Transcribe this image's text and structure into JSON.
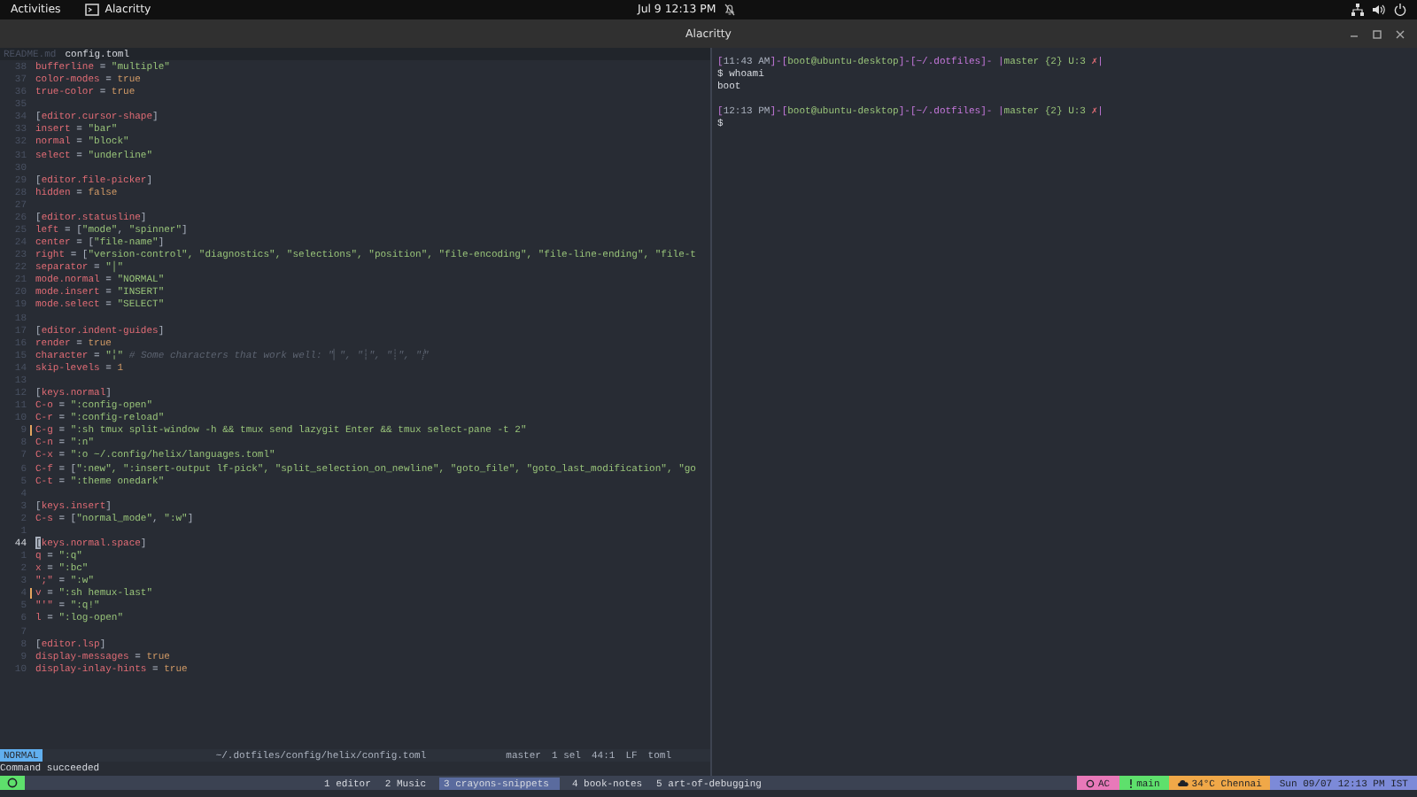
{
  "top_bar": {
    "activities": "Activities",
    "app": "Alacritty",
    "clock": "Jul 9  12:13 PM"
  },
  "window": {
    "title": "Alacritty"
  },
  "editor": {
    "tabs": [
      {
        "label": "README.md",
        "selected": false
      },
      {
        "label": "config.toml",
        "selected": true
      }
    ],
    "lines": [
      {
        "number": "38",
        "current": false,
        "modified": false,
        "tokens": [
          {
            "kind": "key",
            "text": "bufferline"
          },
          {
            "kind": "punct",
            "text": " = "
          },
          {
            "kind": "string",
            "text": "\"multiple\""
          }
        ]
      },
      {
        "number": "37",
        "current": false,
        "modified": false,
        "tokens": [
          {
            "kind": "key",
            "text": "color-modes"
          },
          {
            "kind": "punct",
            "text": " = "
          },
          {
            "kind": "value",
            "text": "true"
          }
        ]
      },
      {
        "number": "36",
        "current": false,
        "modified": false,
        "tokens": [
          {
            "kind": "key",
            "text": "true-color"
          },
          {
            "kind": "punct",
            "text": " = "
          },
          {
            "kind": "value",
            "text": "true"
          }
        ]
      },
      {
        "number": "35",
        "current": false,
        "modified": false
      },
      {
        "number": "34",
        "current": false,
        "modified": false,
        "tokens": [
          {
            "kind": "punct",
            "text": "["
          },
          {
            "kind": "key",
            "text": "editor.cursor-shape"
          },
          {
            "kind": "punct",
            "text": "]"
          }
        ]
      },
      {
        "number": "33",
        "current": false,
        "modified": false,
        "tokens": [
          {
            "kind": "key",
            "text": "insert"
          },
          {
            "kind": "punct",
            "text": " = "
          },
          {
            "kind": "string",
            "text": "\"bar\""
          }
        ]
      },
      {
        "number": "32",
        "current": false,
        "modified": false,
        "tokens": [
          {
            "kind": "key",
            "text": "normal"
          },
          {
            "kind": "punct",
            "text": " = "
          },
          {
            "kind": "string",
            "text": "\"block\""
          }
        ]
      },
      {
        "number": "31",
        "current": false,
        "modified": false,
        "tokens": [
          {
            "kind": "key",
            "text": "select"
          },
          {
            "kind": "punct",
            "text": " = "
          },
          {
            "kind": "string",
            "text": "\"underline\""
          }
        ]
      },
      {
        "number": "30",
        "current": false,
        "modified": false
      },
      {
        "number": "29",
        "current": false,
        "modified": false,
        "tokens": [
          {
            "kind": "punct",
            "text": "["
          },
          {
            "kind": "key",
            "text": "editor.file-picker"
          },
          {
            "kind": "punct",
            "text": "]"
          }
        ]
      },
      {
        "number": "28",
        "current": false,
        "modified": false,
        "tokens": [
          {
            "kind": "key",
            "text": "hidden"
          },
          {
            "kind": "punct",
            "text": " = "
          },
          {
            "kind": "value",
            "text": "false"
          }
        ]
      },
      {
        "number": "27",
        "current": false,
        "modified": false
      },
      {
        "number": "26",
        "current": false,
        "modified": false,
        "tokens": [
          {
            "kind": "punct",
            "text": "["
          },
          {
            "kind": "key",
            "text": "editor.statusline"
          },
          {
            "kind": "punct",
            "text": "]"
          }
        ]
      },
      {
        "number": "25",
        "current": false,
        "modified": false,
        "tokens": [
          {
            "kind": "key",
            "text": "left"
          },
          {
            "kind": "punct",
            "text": " = ["
          },
          {
            "kind": "string",
            "text": "\"mode\""
          },
          {
            "kind": "punct",
            "text": ", "
          },
          {
            "kind": "string",
            "text": "\"spinner\""
          },
          {
            "kind": "punct",
            "text": "]"
          }
        ]
      },
      {
        "number": "24",
        "current": false,
        "modified": false,
        "tokens": [
          {
            "kind": "key",
            "text": "center"
          },
          {
            "kind": "punct",
            "text": " = ["
          },
          {
            "kind": "string",
            "text": "\"file-name\""
          },
          {
            "kind": "punct",
            "text": "]"
          }
        ]
      },
      {
        "number": "23",
        "current": false,
        "modified": false,
        "tokens": [
          {
            "kind": "key",
            "text": "right"
          },
          {
            "kind": "punct",
            "text": " = ["
          },
          {
            "kind": "string",
            "text": "\"version-control\", \"diagnostics\", \"selections\", \"position\", \"file-encoding\", \"file-line-ending\", \"file-t"
          }
        ]
      },
      {
        "number": "22",
        "current": false,
        "modified": false,
        "tokens": [
          {
            "kind": "key",
            "text": "separator"
          },
          {
            "kind": "punct",
            "text": " = "
          },
          {
            "kind": "string",
            "text": "\"│\""
          }
        ]
      },
      {
        "number": "21",
        "current": false,
        "modified": false,
        "tokens": [
          {
            "kind": "key",
            "text": "mode.normal"
          },
          {
            "kind": "punct",
            "text": " = "
          },
          {
            "kind": "string",
            "text": "\"NORMAL\""
          }
        ]
      },
      {
        "number": "20",
        "current": false,
        "modified": false,
        "tokens": [
          {
            "kind": "key",
            "text": "mode.insert"
          },
          {
            "kind": "punct",
            "text": " = "
          },
          {
            "kind": "string",
            "text": "\"INSERT\""
          }
        ]
      },
      {
        "number": "19",
        "current": false,
        "modified": false,
        "tokens": [
          {
            "kind": "key",
            "text": "mode.select"
          },
          {
            "kind": "punct",
            "text": " = "
          },
          {
            "kind": "string",
            "text": "\"SELECT\""
          }
        ]
      },
      {
        "number": "18",
        "current": false,
        "modified": false
      },
      {
        "number": "17",
        "current": false,
        "modified": false,
        "tokens": [
          {
            "kind": "punct",
            "text": "["
          },
          {
            "kind": "key",
            "text": "editor.indent-guides"
          },
          {
            "kind": "punct",
            "text": "]"
          }
        ]
      },
      {
        "number": "16",
        "current": false,
        "modified": false,
        "tokens": [
          {
            "kind": "key",
            "text": "render"
          },
          {
            "kind": "punct",
            "text": " = "
          },
          {
            "kind": "value",
            "text": "true"
          }
        ]
      },
      {
        "number": "15",
        "current": false,
        "modified": false,
        "tokens": [
          {
            "kind": "key",
            "text": "character"
          },
          {
            "kind": "punct",
            "text": " = "
          },
          {
            "kind": "string",
            "text": "\"╎\""
          },
          {
            "kind": "comment",
            "text": " # Some characters that work well: \"▏\", \"┆\", \"┊\", \"⸽\""
          }
        ]
      },
      {
        "number": "14",
        "current": false,
        "modified": false,
        "tokens": [
          {
            "kind": "key",
            "text": "skip-levels"
          },
          {
            "kind": "punct",
            "text": " = "
          },
          {
            "kind": "value",
            "text": "1"
          }
        ]
      },
      {
        "number": "13",
        "current": false,
        "modified": false
      },
      {
        "number": "12",
        "current": false,
        "modified": false,
        "tokens": [
          {
            "kind": "punct",
            "text": "["
          },
          {
            "kind": "key",
            "text": "keys.normal"
          },
          {
            "kind": "punct",
            "text": "]"
          }
        ]
      },
      {
        "number": "11",
        "current": false,
        "modified": false,
        "tokens": [
          {
            "kind": "key",
            "text": "C-o"
          },
          {
            "kind": "punct",
            "text": " = "
          },
          {
            "kind": "string",
            "text": "\":config-open\""
          }
        ]
      },
      {
        "number": "10",
        "current": false,
        "modified": false,
        "tokens": [
          {
            "kind": "key",
            "text": "C-r"
          },
          {
            "kind": "punct",
            "text": " = "
          },
          {
            "kind": "string",
            "text": "\":config-reload\""
          }
        ]
      },
      {
        "number": "9",
        "current": false,
        "modified": true,
        "tokens": [
          {
            "kind": "key",
            "text": "C-g"
          },
          {
            "kind": "punct",
            "text": " = "
          },
          {
            "kind": "string",
            "text": "\":sh tmux split-window -h && tmux send lazygit Enter && tmux select-pane -t 2\""
          }
        ]
      },
      {
        "number": "8",
        "current": false,
        "modified": false,
        "tokens": [
          {
            "kind": "key",
            "text": "C-n"
          },
          {
            "kind": "punct",
            "text": " = "
          },
          {
            "kind": "string",
            "text": "\":n\""
          }
        ]
      },
      {
        "number": "7",
        "current": false,
        "modified": false,
        "tokens": [
          {
            "kind": "key",
            "text": "C-x"
          },
          {
            "kind": "punct",
            "text": " = "
          },
          {
            "kind": "string",
            "text": "\":o ~/.config/helix/languages.toml\""
          }
        ]
      },
      {
        "number": "6",
        "current": false,
        "modified": false,
        "tokens": [
          {
            "kind": "key",
            "text": "C-f"
          },
          {
            "kind": "punct",
            "text": " = ["
          },
          {
            "kind": "string",
            "text": "\":new\", \":insert-output lf-pick\", \"split_selection_on_newline\", \"goto_file\", \"goto_last_modification\", \"go"
          }
        ]
      },
      {
        "number": "5",
        "current": false,
        "modified": false,
        "tokens": [
          {
            "kind": "key",
            "text": "C-t"
          },
          {
            "kind": "punct",
            "text": " = "
          },
          {
            "kind": "string",
            "text": "\":theme onedark\""
          }
        ]
      },
      {
        "number": "4",
        "current": false,
        "modified": false
      },
      {
        "number": "3",
        "current": false,
        "modified": false,
        "tokens": [
          {
            "kind": "punct",
            "text": "["
          },
          {
            "kind": "key",
            "text": "keys.insert"
          },
          {
            "kind": "punct",
            "text": "]"
          }
        ]
      },
      {
        "number": "2",
        "current": false,
        "modified": false,
        "tokens": [
          {
            "kind": "key",
            "text": "C-s"
          },
          {
            "kind": "punct",
            "text": " = ["
          },
          {
            "kind": "string",
            "text": "\"normal_mode\""
          },
          {
            "kind": "punct",
            "text": ", "
          },
          {
            "kind": "string",
            "text": "\":w\""
          },
          {
            "kind": "punct",
            "text": "]"
          }
        ]
      },
      {
        "number": "1",
        "current": false,
        "modified": false
      },
      {
        "number": "44",
        "current": true,
        "modified": false,
        "tokens": [
          {
            "kind": "punct",
            "text": "["
          },
          {
            "kind": "key",
            "text": "keys.normal.space"
          },
          {
            "kind": "punct",
            "text": "]"
          }
        ]
      },
      {
        "number": "1",
        "current": false,
        "modified": false,
        "tokens": [
          {
            "kind": "key",
            "text": "q"
          },
          {
            "kind": "punct",
            "text": " = "
          },
          {
            "kind": "string",
            "text": "\":q\""
          }
        ]
      },
      {
        "number": "2",
        "current": false,
        "modified": false,
        "tokens": [
          {
            "kind": "key",
            "text": "x"
          },
          {
            "kind": "punct",
            "text": " = "
          },
          {
            "kind": "string",
            "text": "\":bc\""
          }
        ]
      },
      {
        "number": "3",
        "current": false,
        "modified": false,
        "tokens": [
          {
            "kind": "key",
            "text": "\";\""
          },
          {
            "kind": "punct",
            "text": " = "
          },
          {
            "kind": "string",
            "text": "\":w\""
          }
        ]
      },
      {
        "number": "4",
        "current": false,
        "modified": true,
        "tokens": [
          {
            "kind": "key",
            "text": "v"
          },
          {
            "kind": "punct",
            "text": " = "
          },
          {
            "kind": "string",
            "text": "\":sh hemux-last\""
          }
        ]
      },
      {
        "number": "5",
        "current": false,
        "modified": false,
        "tokens": [
          {
            "kind": "key",
            "text": "\"'\""
          },
          {
            "kind": "punct",
            "text": " = "
          },
          {
            "kind": "string",
            "text": "\":q!\""
          }
        ]
      },
      {
        "number": "6",
        "current": false,
        "modified": false,
        "tokens": [
          {
            "kind": "key",
            "text": "l"
          },
          {
            "kind": "punct",
            "text": " = "
          },
          {
            "kind": "string",
            "text": "\":log-open\""
          }
        ]
      },
      {
        "number": "7",
        "current": false,
        "modified": false
      },
      {
        "number": "8",
        "current": false,
        "modified": false,
        "tokens": [
          {
            "kind": "punct",
            "text": "["
          },
          {
            "kind": "key",
            "text": "editor.lsp"
          },
          {
            "kind": "punct",
            "text": "]"
          }
        ]
      },
      {
        "number": "9",
        "current": false,
        "modified": false,
        "tokens": [
          {
            "kind": "key",
            "text": "display-messages"
          },
          {
            "kind": "punct",
            "text": " = "
          },
          {
            "kind": "value",
            "text": "true"
          }
        ]
      },
      {
        "number": "10",
        "current": false,
        "modified": false,
        "tokens": [
          {
            "kind": "key",
            "text": "display-inlay-hints"
          },
          {
            "kind": "punct",
            "text": " = "
          },
          {
            "kind": "value",
            "text": "true"
          }
        ]
      }
    ],
    "status_line": {
      "mode": "NORMAL",
      "file": "~/.dotfiles/config/helix/config.toml",
      "branch": "master",
      "selections": "1 sel",
      "position": "44:1",
      "line_ending": "LF",
      "file_type": "toml"
    },
    "message": "Command succeeded"
  },
  "terminal": {
    "sessions": [
      {
        "prompt": [
          {
            "kind": "bracket",
            "text": "["
          },
          {
            "kind": "time",
            "text": "11:43 AM"
          },
          {
            "kind": "bracket",
            "text": "]-["
          },
          {
            "kind": "user",
            "text": "boot@ubuntu-desktop"
          },
          {
            "kind": "bracket",
            "text": "]-["
          },
          {
            "kind": "path",
            "text": "~/.dotfiles"
          },
          {
            "kind": "bracket",
            "text": "]- |"
          },
          {
            "kind": "git",
            "text": "master {2} U:3 "
          },
          {
            "kind": "dirty",
            "text": "✗"
          },
          {
            "kind": "bracket",
            "text": "|"
          }
        ],
        "command": "$ whoami",
        "output": "boot"
      },
      {
        "prompt": [
          {
            "kind": "bracket",
            "text": "["
          },
          {
            "kind": "time",
            "text": "12:13 PM"
          },
          {
            "kind": "bracket",
            "text": "]-["
          },
          {
            "kind": "user",
            "text": "boot@ubuntu-desktop"
          },
          {
            "kind": "bracket",
            "text": "]-["
          },
          {
            "kind": "path",
            "text": "~/.dotfiles"
          },
          {
            "kind": "bracket",
            "text": "]- |"
          },
          {
            "kind": "git",
            "text": "master {2} U:3 "
          },
          {
            "kind": "dirty",
            "text": "✗"
          },
          {
            "kind": "bracket",
            "text": "|"
          }
        ],
        "command": "$"
      }
    ]
  },
  "tmux": {
    "windows": [
      {
        "label": "1 editor",
        "selected": false
      },
      {
        "label": "2 Music",
        "selected": false
      },
      {
        "label": "3 crayons-snippets",
        "selected": true
      },
      {
        "label": "4 book-notes",
        "selected": false
      },
      {
        "label": "5 art-of-debugging",
        "selected": false
      }
    ],
    "widgets": [
      {
        "kind": "power",
        "text": "AC",
        "color": "#e879b9"
      },
      {
        "kind": "branch",
        "text": "main",
        "color": "#5ee06c"
      },
      {
        "kind": "weather",
        "text": "34°C Chennai",
        "color": "#f0a848"
      },
      {
        "kind": "clock",
        "text": "Sun 09/07 12:13 PM IST",
        "color": "#7c8ad8"
      }
    ]
  }
}
